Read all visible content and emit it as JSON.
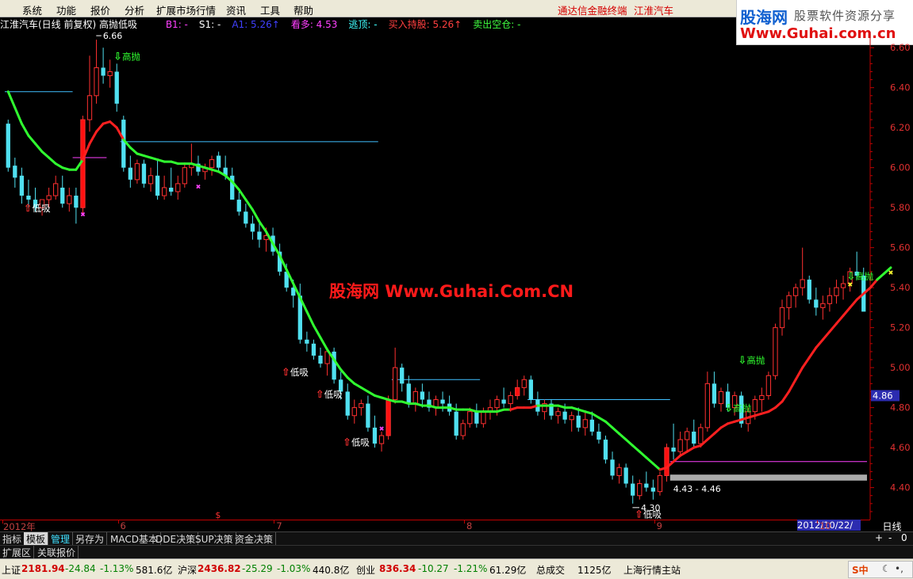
{
  "menu": {
    "items": [
      "系统",
      "功能",
      "报价",
      "分析",
      "扩展市场行情",
      "资讯",
      "工具",
      "帮助"
    ],
    "app_title": "通达信金融终端",
    "stock_name": "江淮汽车"
  },
  "logo": {
    "cn": "股海网",
    "tagline": "股票软件资源分享",
    "url": "Www.Guhai.com.cn"
  },
  "header": {
    "title": "江淮汽车(日线 前复权) 高抛低吸",
    "indicators": [
      {
        "text": "B1: -",
        "color": "#ff40ff"
      },
      {
        "text": "S1: -",
        "color": "#ffffff"
      },
      {
        "text": "A1: 5.26↑",
        "color": "#4040ff"
      },
      {
        "text": "看多: 4.53",
        "color": "#ff40ff"
      },
      {
        "text": "逃顶: -",
        "color": "#40ffff"
      },
      {
        "text": "买入持股: 5.26↑",
        "color": "#ff4040"
      },
      {
        "text": "卖出空仓: -",
        "color": "#40ff40"
      }
    ]
  },
  "chart_data": {
    "type": "candlestick",
    "y_ticks": [
      "6.60",
      "6.40",
      "6.20",
      "6.00",
      "5.80",
      "5.60",
      "5.40",
      "5.20",
      "5.00",
      "4.80",
      "4.60",
      "4.40"
    ],
    "ylim": [
      4.24,
      6.68
    ],
    "current_price": "4.86",
    "x_labels": [
      {
        "label": "2012年",
        "index": 0
      },
      {
        "label": "6",
        "index": 17
      },
      {
        "label": "7",
        "index": 40
      },
      {
        "label": "8",
        "index": 68
      },
      {
        "label": "9",
        "index": 96
      },
      {
        "label": "10",
        "index": 120
      }
    ],
    "x_cursor_date": "2012/10/22/—",
    "period": "日线",
    "candles": [
      [
        6.22,
        6.24,
        5.98,
        6.0
      ],
      [
        6.01,
        6.05,
        5.9,
        5.95
      ],
      [
        5.96,
        6.0,
        5.82,
        5.86
      ],
      [
        5.86,
        5.94,
        5.8,
        5.84
      ],
      [
        5.84,
        5.9,
        5.78,
        5.8
      ],
      [
        5.8,
        5.84,
        5.76,
        5.84
      ],
      [
        5.84,
        5.9,
        5.8,
        5.86
      ],
      [
        5.86,
        5.96,
        5.84,
        5.92
      ],
      [
        5.9,
        5.96,
        5.8,
        5.82
      ],
      [
        5.82,
        5.9,
        5.78,
        5.86
      ],
      [
        5.86,
        5.9,
        5.72,
        5.8
      ],
      [
        5.8,
        6.26,
        5.76,
        6.24
      ],
      [
        6.24,
        6.56,
        6.18,
        6.36
      ],
      [
        6.36,
        6.64,
        6.32,
        6.5
      ],
      [
        6.5,
        6.6,
        6.42,
        6.46
      ],
      [
        6.46,
        6.54,
        6.4,
        6.48
      ],
      [
        6.48,
        6.52,
        6.28,
        6.32
      ],
      [
        6.24,
        6.26,
        5.98,
        6.0
      ],
      [
        6.0,
        6.06,
        5.9,
        5.94
      ],
      [
        5.94,
        6.04,
        5.92,
        6.02
      ],
      [
        6.02,
        6.04,
        5.9,
        5.92
      ],
      [
        5.92,
        6.0,
        5.88,
        5.96
      ],
      [
        5.96,
        6.04,
        5.84,
        5.86
      ],
      [
        5.86,
        5.96,
        5.84,
        5.9
      ],
      [
        5.9,
        6.0,
        5.86,
        5.88
      ],
      [
        5.88,
        5.96,
        5.84,
        5.92
      ],
      [
        5.92,
        6.02,
        5.9,
        6.0
      ],
      [
        6.0,
        6.12,
        5.96,
        6.02
      ],
      [
        6.02,
        6.06,
        5.96,
        5.98
      ],
      [
        5.98,
        6.02,
        5.94,
        6.0
      ],
      [
        6.0,
        6.06,
        5.96,
        6.04
      ],
      [
        6.06,
        6.08,
        5.98,
        6.0
      ],
      [
        6.0,
        6.06,
        5.94,
        5.96
      ],
      [
        5.96,
        6.0,
        5.84,
        5.84
      ],
      [
        5.84,
        5.88,
        5.76,
        5.78
      ],
      [
        5.78,
        5.82,
        5.7,
        5.72
      ],
      [
        5.72,
        5.76,
        5.64,
        5.68
      ],
      [
        5.68,
        5.74,
        5.6,
        5.64
      ],
      [
        5.64,
        5.7,
        5.58,
        5.66
      ],
      [
        5.66,
        5.7,
        5.56,
        5.58
      ],
      [
        5.58,
        5.62,
        5.46,
        5.48
      ],
      [
        5.48,
        5.52,
        5.38,
        5.4
      ],
      [
        5.4,
        5.44,
        5.3,
        5.36
      ],
      [
        5.36,
        5.42,
        5.12,
        5.14
      ],
      [
        5.14,
        5.18,
        5.08,
        5.12
      ],
      [
        5.12,
        5.14,
        5.04,
        5.06
      ],
      [
        5.06,
        5.1,
        5.0,
        5.02
      ],
      [
        5.02,
        5.1,
        4.96,
        5.08
      ],
      [
        5.08,
        5.1,
        4.92,
        4.94
      ],
      [
        4.94,
        4.98,
        4.84,
        4.88
      ],
      [
        4.88,
        4.92,
        4.74,
        4.76
      ],
      [
        4.76,
        4.84,
        4.72,
        4.8
      ],
      [
        4.8,
        4.84,
        4.76,
        4.82
      ],
      [
        4.82,
        4.86,
        4.68,
        4.7
      ],
      [
        4.7,
        4.76,
        4.6,
        4.62
      ],
      [
        4.62,
        4.68,
        4.58,
        4.66
      ],
      [
        4.66,
        4.86,
        4.64,
        4.84
      ],
      [
        4.84,
        5.1,
        4.82,
        5.0
      ],
      [
        5.0,
        5.02,
        4.88,
        4.92
      ],
      [
        4.92,
        4.96,
        4.8,
        4.82
      ],
      [
        4.82,
        4.9,
        4.78,
        4.88
      ],
      [
        4.88,
        4.92,
        4.8,
        4.84
      ],
      [
        4.84,
        4.88,
        4.78,
        4.8
      ],
      [
        4.8,
        4.86,
        4.76,
        4.84
      ],
      [
        4.84,
        4.88,
        4.78,
        4.82
      ],
      [
        4.82,
        4.86,
        4.76,
        4.78
      ],
      [
        4.78,
        4.82,
        4.64,
        4.66
      ],
      [
        4.66,
        4.74,
        4.64,
        4.72
      ],
      [
        4.72,
        4.8,
        4.7,
        4.78
      ],
      [
        4.78,
        4.82,
        4.7,
        4.72
      ],
      [
        4.72,
        4.8,
        4.7,
        4.78
      ],
      [
        4.78,
        4.84,
        4.74,
        4.8
      ],
      [
        4.8,
        4.86,
        4.76,
        4.84
      ],
      [
        4.84,
        4.9,
        4.8,
        4.82
      ],
      [
        4.82,
        4.88,
        4.78,
        4.86
      ],
      [
        4.86,
        4.94,
        4.84,
        4.9
      ],
      [
        4.9,
        4.96,
        4.86,
        4.94
      ],
      [
        4.94,
        4.96,
        4.82,
        4.84
      ],
      [
        4.84,
        4.88,
        4.76,
        4.78
      ],
      [
        4.78,
        4.84,
        4.74,
        4.82
      ],
      [
        4.82,
        4.84,
        4.74,
        4.76
      ],
      [
        4.76,
        4.8,
        4.72,
        4.78
      ],
      [
        4.78,
        4.82,
        4.72,
        4.74
      ],
      [
        4.74,
        4.78,
        4.68,
        4.76
      ],
      [
        4.76,
        4.8,
        4.68,
        4.7
      ],
      [
        4.7,
        4.78,
        4.66,
        4.74
      ],
      [
        4.74,
        4.78,
        4.66,
        4.68
      ],
      [
        4.68,
        4.72,
        4.62,
        4.64
      ],
      [
        4.64,
        4.66,
        4.52,
        4.54
      ],
      [
        4.54,
        4.58,
        4.44,
        4.46
      ],
      [
        4.46,
        4.52,
        4.42,
        4.5
      ],
      [
        4.5,
        4.52,
        4.4,
        4.42
      ],
      [
        4.42,
        4.46,
        4.32,
        4.36
      ],
      [
        4.36,
        4.44,
        4.34,
        4.42
      ],
      [
        4.42,
        4.48,
        4.38,
        4.4
      ],
      [
        4.4,
        4.44,
        4.34,
        4.38
      ],
      [
        4.38,
        4.48,
        4.36,
        4.46
      ],
      [
        4.46,
        4.62,
        4.43,
        4.6
      ],
      [
        4.6,
        4.72,
        4.54,
        4.58
      ],
      [
        4.58,
        4.68,
        4.56,
        4.64
      ],
      [
        4.64,
        4.7,
        4.58,
        4.68
      ],
      [
        4.68,
        4.74,
        4.6,
        4.62
      ],
      [
        4.62,
        4.72,
        4.6,
        4.7
      ],
      [
        4.7,
        4.98,
        4.68,
        4.92
      ],
      [
        4.92,
        4.98,
        4.8,
        4.82
      ],
      [
        4.82,
        4.9,
        4.78,
        4.88
      ],
      [
        4.88,
        4.92,
        4.78,
        4.8
      ],
      [
        4.8,
        4.88,
        4.76,
        4.86
      ],
      [
        4.86,
        4.88,
        4.7,
        4.72
      ],
      [
        4.72,
        4.8,
        4.68,
        4.78
      ],
      [
        4.78,
        4.86,
        4.74,
        4.84
      ],
      [
        4.84,
        4.9,
        4.78,
        4.86
      ],
      [
        4.86,
        4.98,
        4.84,
        4.96
      ],
      [
        4.96,
        5.22,
        4.94,
        5.2
      ],
      [
        5.2,
        5.34,
        5.16,
        5.3
      ],
      [
        5.3,
        5.38,
        5.24,
        5.36
      ],
      [
        5.36,
        5.42,
        5.3,
        5.4
      ],
      [
        5.4,
        5.6,
        5.36,
        5.44
      ],
      [
        5.44,
        5.46,
        5.32,
        5.34
      ],
      [
        5.34,
        5.4,
        5.26,
        5.3
      ],
      [
        5.3,
        5.36,
        5.24,
        5.32
      ],
      [
        5.32,
        5.4,
        5.28,
        5.36
      ],
      [
        5.36,
        5.44,
        5.32,
        5.4
      ],
      [
        5.4,
        5.46,
        5.34,
        5.42
      ],
      [
        5.42,
        5.5,
        5.38,
        5.48
      ],
      [
        5.48,
        5.58,
        5.44,
        5.46
      ],
      [
        5.46,
        5.5,
        5.28,
        5.28
      ]
    ],
    "trend_line": {
      "values": [
        6.38,
        6.3,
        6.22,
        6.16,
        6.12,
        6.08,
        6.05,
        6.02,
        6.0,
        5.99,
        5.99,
        6.04,
        6.12,
        6.18,
        6.22,
        6.23,
        6.2,
        6.14,
        6.1,
        6.07,
        6.06,
        6.05,
        6.04,
        6.03,
        6.03,
        6.02,
        6.02,
        6.02,
        6.01,
        6.0,
        5.99,
        5.98,
        5.96,
        5.93,
        5.89,
        5.84,
        5.79,
        5.73,
        5.68,
        5.62,
        5.56,
        5.49,
        5.42,
        5.35,
        5.28,
        5.21,
        5.15,
        5.09,
        5.04,
        4.99,
        4.95,
        4.92,
        4.9,
        4.88,
        4.86,
        4.85,
        4.84,
        4.83,
        4.83,
        4.82,
        4.82,
        4.81,
        4.81,
        4.8,
        4.8,
        4.8,
        4.79,
        4.79,
        4.79,
        4.78,
        4.78,
        4.78,
        4.78,
        4.79,
        4.79,
        4.8,
        4.8,
        4.8,
        4.81,
        4.81,
        4.81,
        4.81,
        4.8,
        4.8,
        4.79,
        4.78,
        4.77,
        4.75,
        4.73,
        4.7,
        4.67,
        4.64,
        4.61,
        4.58,
        4.55,
        4.52,
        4.49,
        4.5,
        4.53,
        4.56,
        4.58,
        4.6,
        4.61,
        4.64,
        4.67,
        4.7,
        4.72,
        4.73,
        4.74,
        4.75,
        4.76,
        4.77,
        4.78,
        4.8,
        4.83,
        4.88,
        4.94,
        5.0,
        5.05,
        5.1,
        5.14,
        5.18,
        5.22,
        5.26,
        5.3,
        5.34,
        5.37,
        5.4,
        5.44,
        5.47,
        5.5
      ],
      "red_ranges": [
        [
          11,
          17
        ],
        [
          74,
          78
        ],
        [
          96,
          128
        ]
      ]
    },
    "annotations": {
      "high_label": "6.66",
      "low_label": "4.30",
      "range_label": "4.43 - 4.46",
      "buy_labels": [
        "低吸",
        "低吸",
        "低吸",
        "低吸",
        "低吸"
      ],
      "sell_labels": [
        "高抛",
        "高抛",
        "高抛",
        "高抛"
      ]
    }
  },
  "watermark": "股海网 Www.Guhai.Com.CN",
  "tabs": {
    "row1": [
      "指标",
      "模板",
      "管理",
      "另存为",
      "MACD基本",
      "DDE决策",
      "SUP决策",
      "资金决策"
    ],
    "row1_selected": "模板",
    "row1_highlight": "管理",
    "controls": [
      "+",
      "-",
      "0"
    ],
    "row2": [
      "扩展区",
      "关联报价"
    ]
  },
  "status": {
    "sh_label": "上证",
    "sh_val": "2181.94",
    "sh_chg": "-24.84",
    "sh_pct": "-1.13%",
    "sh_amt": "581.6亿",
    "sz_label": "沪深",
    "sz_val": "2436.82",
    "sz_chg": "-25.29",
    "sz_pct": "-1.03%",
    "sz_amt": "440.8亿",
    "cy_label": "创业",
    "cy_val": "836.34",
    "cy_chg": "-10.27",
    "cy_pct": "-1.21%",
    "cy_amt": "61.29亿",
    "total_label": "总成交",
    "total_val": "1125亿",
    "server": "上海行情主站",
    "ime_text": "S中"
  }
}
